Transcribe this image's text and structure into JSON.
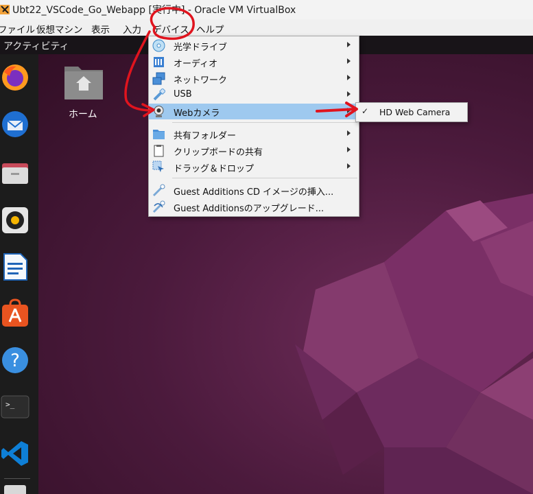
{
  "window": {
    "title": "Ubt22_VSCode_Go_Webapp [実行中] - Oracle VM VirtualBox"
  },
  "menubar": {
    "items": [
      {
        "label": "ファイル"
      },
      {
        "label": "仮想マシン"
      },
      {
        "label": "表示"
      },
      {
        "label": "入力"
      },
      {
        "label": "デバイス"
      },
      {
        "label": "ヘルプ"
      }
    ]
  },
  "ubuntu": {
    "topbar": {
      "activities": "アクティビティ"
    },
    "dock": [
      "firefox-icon",
      "thunderbird-icon",
      "files-icon",
      "rhythmbox-icon",
      "writer-icon",
      "app-center-icon",
      "help-icon",
      "terminal-icon",
      "vscode-icon",
      "drive-icon"
    ],
    "desktop": {
      "home_label": "ホーム"
    }
  },
  "devices_menu": {
    "items": [
      {
        "label": "光学ドライブ",
        "icon": "optical-drive-icon",
        "submenu": true
      },
      {
        "label": "オーディオ",
        "icon": "audio-icon",
        "submenu": true
      },
      {
        "label": "ネットワーク",
        "icon": "network-icon",
        "submenu": true
      },
      {
        "label": "USB",
        "icon": "usb-icon",
        "submenu": true
      },
      {
        "label": "Webカメラ",
        "icon": "webcam-icon",
        "submenu": true,
        "selected": true
      },
      {
        "label": "共有フォルダー",
        "icon": "shared-folder-icon",
        "submenu": true
      },
      {
        "label": "クリップボードの共有",
        "icon": "clipboard-icon",
        "submenu": true
      },
      {
        "label": "ドラッグ＆ドロップ",
        "icon": "drag-drop-icon",
        "submenu": true
      },
      {
        "label": "Guest Additions CD イメージの挿入...",
        "icon": "guest-additions-cd-icon",
        "submenu": false
      },
      {
        "label": "Guest Additionsのアップグレード...",
        "icon": "guest-additions-upgrade-icon",
        "submenu": false
      }
    ]
  },
  "webcam_submenu": {
    "items": [
      {
        "label": "HD Web Camera",
        "checked": true,
        "check_glyph": "✓"
      }
    ]
  },
  "colors": {
    "selection": "#9ec9ef",
    "annotation_red": "#e0141e",
    "ubuntu_orange": "#e95420"
  }
}
